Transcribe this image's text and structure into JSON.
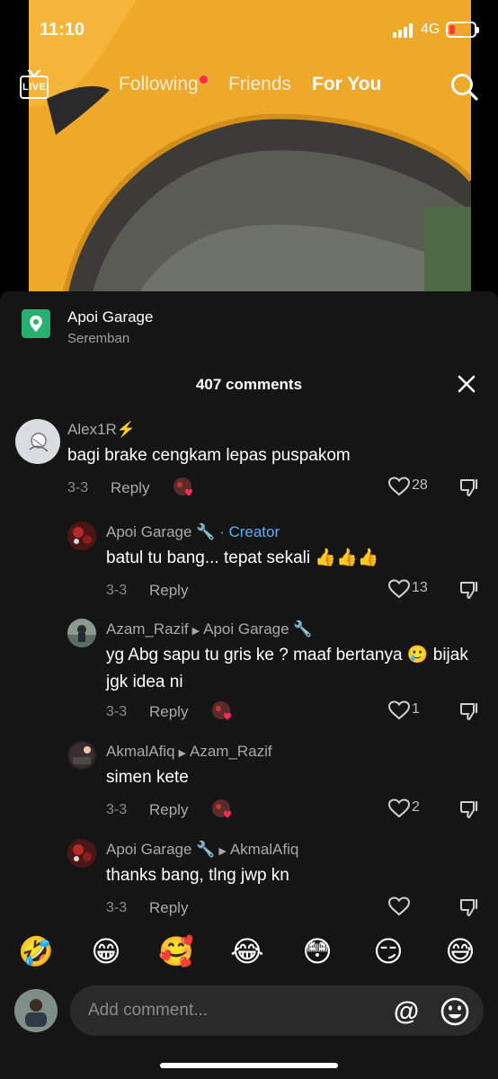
{
  "status_bar": {
    "time": "11:10",
    "network": "4G"
  },
  "top_nav": {
    "live_label": "LIVE",
    "tabs": [
      {
        "label": "Following",
        "has_dot": true
      },
      {
        "label": "Friends"
      },
      {
        "label": "For You",
        "active": true
      }
    ]
  },
  "location": {
    "name": "Apoi Garage",
    "city": "Seremban"
  },
  "comments_header": {
    "count_label": "407 comments"
  },
  "comments": [
    {
      "user": "Alex1R⚡️",
      "text": "bagi brake cengkam lepas puspakom",
      "date": "3-3",
      "reply_label": "Reply",
      "likes": "28",
      "creator_liked": true
    },
    {
      "user": "Apoi Garage 🔧",
      "creator_tag": "· Creator",
      "text": "batul tu bang... tepat sekali 👍👍👍",
      "date": "3-3",
      "reply_label": "Reply",
      "likes": "13",
      "creator_liked": false
    },
    {
      "user": "Azam_Razif",
      "reply_to": "Apoi Garage 🔧",
      "text": "yg Abg sapu tu gris ke ? maaf bertanya 🥲 bijak jgk idea ni",
      "date": "3-3",
      "reply_label": "Reply",
      "likes": "1",
      "creator_liked": true
    },
    {
      "user": "AkmalAfiq",
      "reply_to": "Azam_Razif",
      "text": "simen kete",
      "date": "3-3",
      "reply_label": "Reply",
      "likes": "2",
      "creator_liked": true
    },
    {
      "user": "Apoi Garage 🔧",
      "reply_to": "AkmalAfiq",
      "text": "thanks bang, tlng jwp kn",
      "date": "3-3",
      "reply_label": "Reply",
      "likes": "",
      "creator_liked": false
    }
  ],
  "emoji_bar": [
    "🤣",
    "😁",
    "🥰",
    "😂",
    "😳",
    "😏",
    "😅"
  ],
  "input": {
    "placeholder": "Add comment...",
    "mention_symbol": "@"
  },
  "colors": {
    "sheet_bg": "#151515",
    "creator_blue": "#5bb0ff",
    "location_green": "#27b06e",
    "accent_red": "#fe2c55"
  }
}
